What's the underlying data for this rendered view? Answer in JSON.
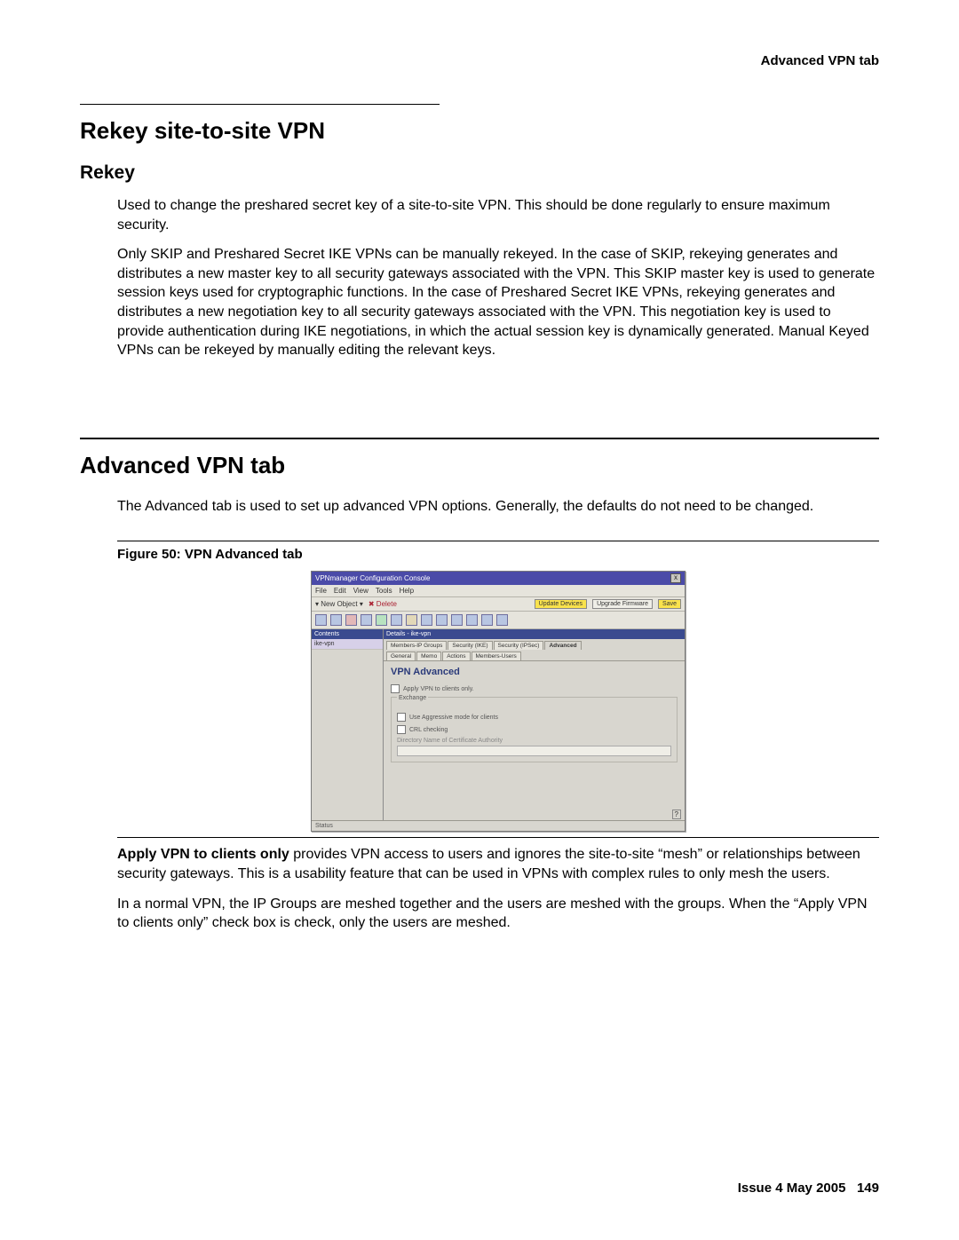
{
  "running_head": "Advanced VPN tab",
  "rekey": {
    "heading": "Rekey site-to-site VPN",
    "subheading": "Rekey",
    "para1": "Used to change the preshared secret key of a site-to-site VPN. This should be done regularly to ensure maximum security.",
    "para2": "Only SKIP and Preshared Secret IKE VPNs can be manually rekeyed. In the case of SKIP, rekeying generates and distributes a new master key to all security gateways associated with the VPN. This SKIP master key is used to generate session keys used for cryptographic functions. In the case of Preshared Secret IKE VPNs, rekeying generates and distributes a new negotiation key to all security gateways associated with the VPN. This negotiation key is used to provide authentication during IKE negotiations, in which the actual session key is dynamically generated. Manual Keyed VPNs can be rekeyed by manually editing the relevant keys."
  },
  "adv": {
    "heading": "Advanced VPN tab",
    "intro": "The Advanced tab is used to set up advanced VPN options. Generally, the defaults do not need to be changed.",
    "fig_caption": "Figure 50: VPN Advanced tab",
    "para_apply_label": "Apply VPN to clients only",
    "para_apply_rest": " provides VPN access to users and ignores the site-to-site “mesh” or relationships between security gateways. This is a usability feature that can be used in VPNs with complex rules to only mesh the users.",
    "para_normal": "In a normal VPN, the IP Groups are meshed together and the users are meshed with the groups. When the “Apply VPN to clients only” check box is check, only the users are meshed."
  },
  "mock": {
    "title": "VPNmanager Configuration Console",
    "menu": [
      "File",
      "Edit",
      "View",
      "Tools",
      "Help"
    ],
    "newobj": "New Object",
    "delete": "Delete",
    "btn_update": "Update Devices",
    "btn_upgrade": "Upgrade Firmware",
    "btn_save": "Save",
    "contents": "Contents",
    "item": "ike-vpn",
    "details": "Details - ike-vpn",
    "tabs_row1": [
      "Members-IP Groups",
      "Security (IKE)",
      "Security (IPSec)",
      "Advanced"
    ],
    "tabs_row2": [
      "General",
      "Memo",
      "Actions",
      "Members-Users"
    ],
    "pane_title": "VPN Advanced",
    "chk_apply": "Apply VPN to clients only.",
    "fieldset": "Exchange",
    "chk_aggr": "Use Aggressive mode for clients",
    "chk_crl": "CRL checking",
    "dn_label": "Directory Name of Certificate Authority",
    "status": "Status"
  },
  "footer": {
    "issue": "Issue 4   May 2005",
    "page": "149"
  }
}
